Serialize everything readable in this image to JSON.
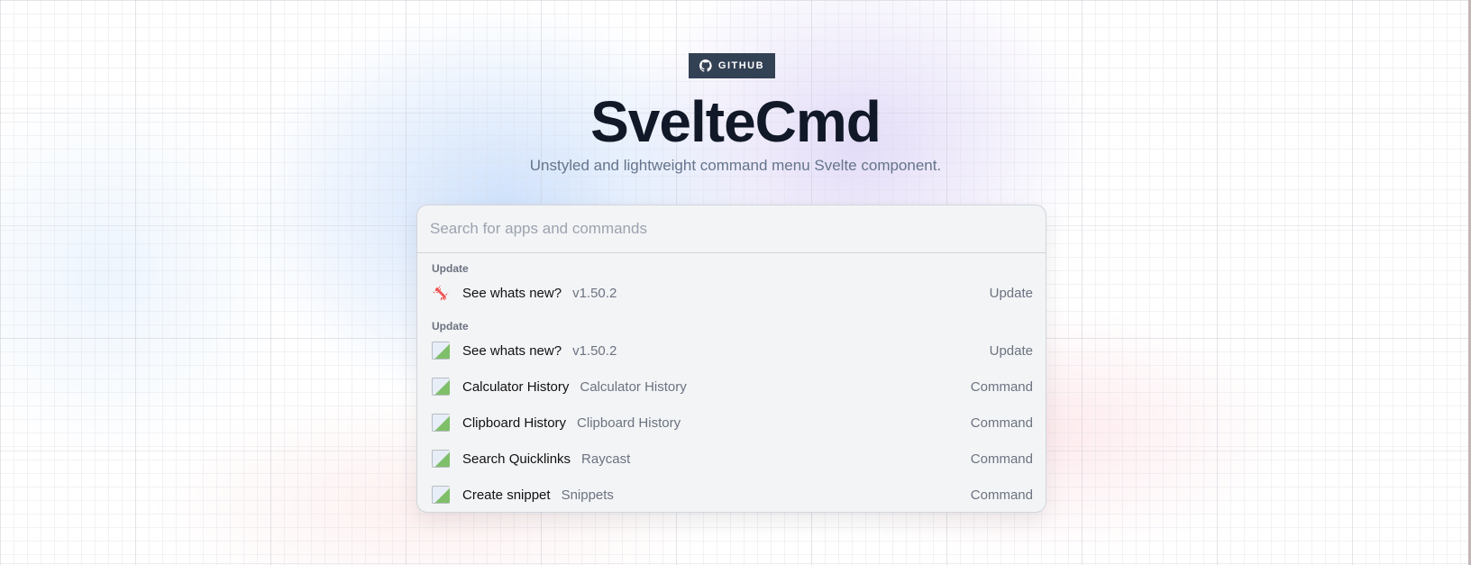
{
  "github_label": "GITHUB",
  "title": "SvelteCmd",
  "subtitle": "Unstyled and lightweight command menu Svelte component.",
  "search": {
    "placeholder": "Search for apps and commands",
    "value": ""
  },
  "groups": [
    {
      "heading": "Update",
      "items": [
        {
          "title": "See whats new?",
          "subtitle": "v1.50.2",
          "kind": "Update",
          "icon": "raycast-icon"
        }
      ]
    },
    {
      "heading": "Update",
      "items": [
        {
          "title": "See whats new?",
          "subtitle": "v1.50.2",
          "kind": "Update",
          "icon": "broken-image-icon"
        },
        {
          "title": "Calculator History",
          "subtitle": "Calculator History",
          "kind": "Command",
          "icon": "broken-image-icon"
        },
        {
          "title": "Clipboard History",
          "subtitle": "Clipboard History",
          "kind": "Command",
          "icon": "broken-image-icon"
        },
        {
          "title": "Search Quicklinks",
          "subtitle": "Raycast",
          "kind": "Command",
          "icon": "broken-image-icon"
        },
        {
          "title": "Create snippet",
          "subtitle": "Snippets",
          "kind": "Command",
          "icon": "broken-image-icon"
        }
      ]
    }
  ]
}
